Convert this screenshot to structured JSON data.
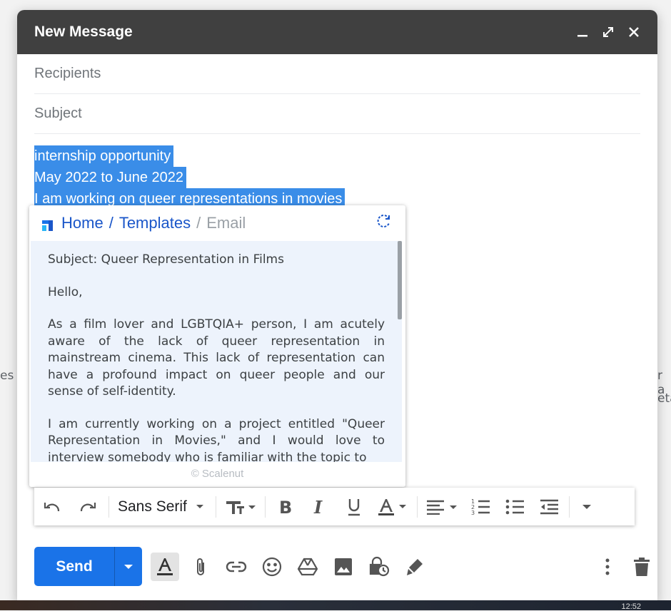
{
  "background": {
    "left_fragment": "es",
    "right_fragment_1": "r a",
    "right_fragment_2": "eta",
    "clock": "12:52"
  },
  "compose": {
    "title": "New Message",
    "recipients_placeholder": "Recipients",
    "subject_placeholder": "Subject",
    "body_lines": [
      "internship opportunity",
      "May 2022 to June 2022",
      "I am working on queer representations in movies"
    ]
  },
  "popup": {
    "breadcrumb": {
      "home": "Home",
      "separator": "/",
      "templates": "Templates",
      "current": "Email"
    },
    "paragraphs": [
      "Subject: Queer Representation in Films",
      "Hello,",
      "As a film lover and LGBTQIA+ person, I am acutely aware of the lack of queer representation in mainstream cinema. This lack of representation can have a profound impact on queer people and our sense of self-identity.",
      "I am currently working on a project entitled \"Queer Representation in Movies,\" and I would love to interview somebody who is familiar with the topic to"
    ],
    "footer": "© Scalenut"
  },
  "toolbar": {
    "font": "Sans Serif"
  },
  "send": {
    "label": "Send"
  },
  "colors": {
    "titlebar": "#404040",
    "send": "#1a73e8",
    "selection": "#3a8de8",
    "link": "#1a56c9"
  }
}
